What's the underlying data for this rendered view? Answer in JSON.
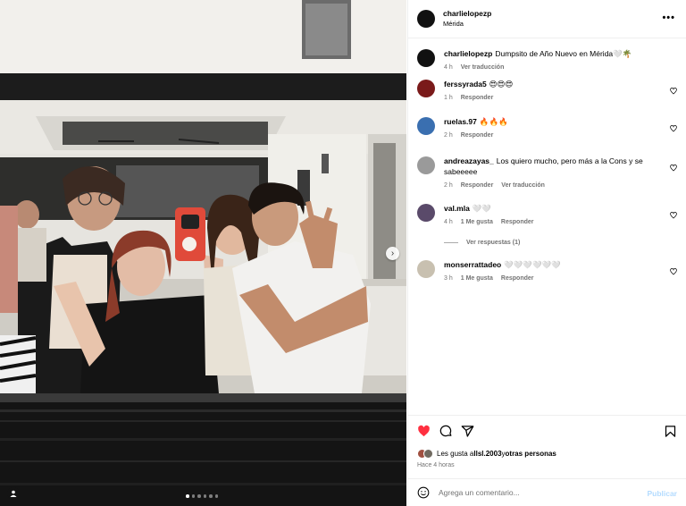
{
  "post": {
    "author": "charlielopezp",
    "location": "Mérida",
    "more_icon": "more-horizontal-icon",
    "caption": "Dumpsito de Año Nuevo en Mérida🤍🌴",
    "caption_time": "4 h",
    "caption_translate": "Ver traducción",
    "carousel_dots": 6,
    "carousel_active": 0
  },
  "comments": [
    {
      "user": "ferssyrada5",
      "text": "😍😍😍",
      "time": "1 h",
      "likes": "",
      "reply": "Responder",
      "translate": "",
      "avatar_color": "#7a1a1a"
    },
    {
      "user": "ruelas.97",
      "text": "🔥🔥🔥",
      "time": "2 h",
      "likes": "",
      "reply": "Responder",
      "translate": "",
      "avatar_color": "#3a6fb0"
    },
    {
      "user": "andreazayas_",
      "text": "Los quiero mucho, pero más a la Cons y se sabeeeee",
      "time": "2 h",
      "likes": "",
      "reply": "Responder",
      "translate": "Ver traducción",
      "avatar_color": "#9a9a9a"
    },
    {
      "user": "val.mla",
      "text": "🤍🤍",
      "time": "4 h",
      "likes": "1 Me gusta",
      "reply": "Responder",
      "translate": "",
      "avatar_color": "#5a4a6a"
    },
    {
      "user": "monserrattadeo",
      "text": "🤍🤍🤍🤍🤍🤍",
      "time": "3 h",
      "likes": "1 Me gusta",
      "reply": "Responder",
      "translate": "",
      "avatar_color": "#c8c0b0"
    }
  ],
  "view_replies": "Ver respuestas (1)",
  "actions": {
    "like_icon": "heart-filled-icon",
    "comment_icon": "comment-icon",
    "share_icon": "share-icon",
    "save_icon": "bookmark-icon",
    "like_color": "#ff3040"
  },
  "likes_summary": {
    "prefix": "Les gusta a ",
    "user": "llsl.2003",
    "middle": " y ",
    "others": "otras personas"
  },
  "post_time": "Hace 4 horas",
  "composer": {
    "placeholder": "Agrega un comentario...",
    "post_label": "Publicar",
    "emoji_icon": "smiley-icon"
  }
}
